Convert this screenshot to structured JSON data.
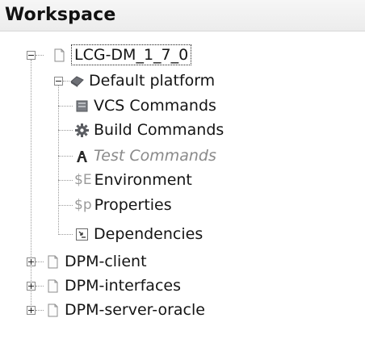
{
  "panel": {
    "title": "Workspace"
  },
  "tree": {
    "root": {
      "label": "LCG-DM_1_7_0",
      "expanded": true,
      "icon": "file-icon",
      "platform": {
        "label": "Default platform",
        "expanded": true,
        "icon": "platform-icon",
        "items": [
          {
            "label": "VCS Commands",
            "icon": "vcs-icon",
            "disabled": false
          },
          {
            "label": "Build Commands",
            "icon": "gear-icon",
            "disabled": false
          },
          {
            "label": "Test Commands",
            "icon": "test-icon",
            "disabled": true
          },
          {
            "label": "Environment",
            "prefix": "$E",
            "icon": "env-icon",
            "disabled": false
          },
          {
            "label": "Properties",
            "prefix": "$p",
            "icon": "props-icon",
            "disabled": false
          },
          {
            "label": "Dependencies",
            "icon": "dependencies-icon",
            "disabled": false
          }
        ]
      }
    },
    "siblings": [
      {
        "label": "DPM-client",
        "expanded": false,
        "icon": "file-icon"
      },
      {
        "label": "DPM-interfaces",
        "expanded": false,
        "icon": "file-icon"
      },
      {
        "label": "DPM-server-oracle",
        "expanded": false,
        "icon": "file-icon"
      }
    ]
  },
  "colors": {
    "header_bg": "#ececec",
    "connector": "#9a9a9a",
    "disabled_text": "#8a8a8a",
    "platform_icon": "#6e7076"
  }
}
